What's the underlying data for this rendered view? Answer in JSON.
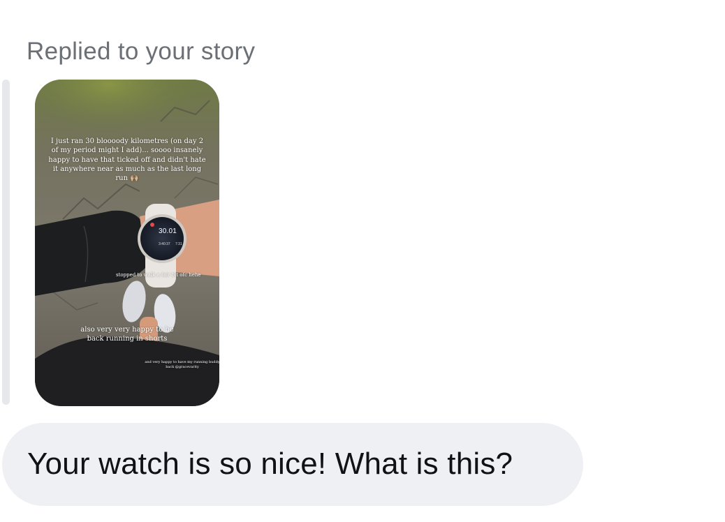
{
  "reply_label": "Replied to your story",
  "story": {
    "caption_main": "I just ran 30 bloooody kilometres (on day 2 of my period might I add)... soooo insanely happy to have that ticked off and didn't hate it anywhere near as much as the last long run 🙌🏼",
    "caption_walk": "stopped to walk a fair bit ofc hehe",
    "caption_shorts": "also very very happy to be back running in shorts",
    "caption_buddy": "and very happy to have my running buddy back @gracevarity",
    "watch": {
      "distance": "30.01",
      "time": "3:40:37",
      "pace": "7:31"
    }
  },
  "message": {
    "text": "Your watch is so nice! What is this?"
  },
  "colors": {
    "label_gray": "#6b6f76",
    "bubble_bg": "#eff0f4",
    "quote_bar": "#e7e8ec"
  }
}
